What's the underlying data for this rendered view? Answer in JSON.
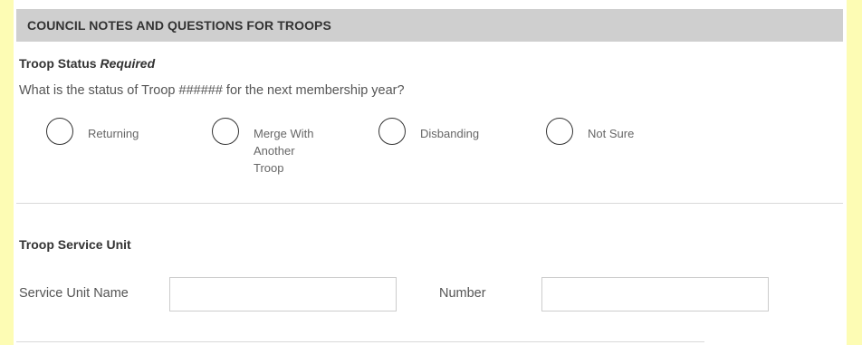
{
  "section": {
    "title": "COUNCIL NOTES AND QUESTIONS FOR TROOPS"
  },
  "troop_status": {
    "label": "Troop Status",
    "required_text": "Required",
    "question": "What is the status of Troop ###### for the next membership year?",
    "options": [
      {
        "label": "Returning",
        "selected": false
      },
      {
        "label": "Merge With\nAnother\nTroop",
        "selected": false
      },
      {
        "label": "Disbanding",
        "selected": false
      },
      {
        "label": "Not Sure",
        "selected": false
      }
    ]
  },
  "service_unit": {
    "heading": "Troop Service Unit",
    "name_label": "Service Unit Name",
    "name_value": "",
    "number_label": "Number",
    "number_value": ""
  },
  "colors": {
    "background_side": "#fdfcb4",
    "header_bg": "#cfcfcf"
  }
}
